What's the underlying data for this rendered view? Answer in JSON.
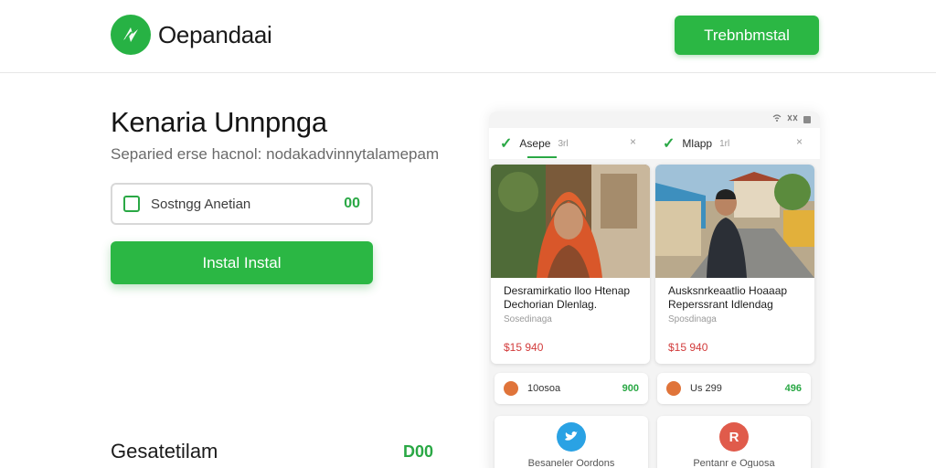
{
  "header": {
    "app_name": "Oepandaai",
    "cta_label": "Trebnbmstal"
  },
  "hero": {
    "title": "Kenaria Unnpnga",
    "subtitle": "Separied erse hacnol: nodakadvinnytalamepam",
    "input": {
      "value": "Sostngg Anetian",
      "count": "00"
    },
    "install_label": "Instal Instal"
  },
  "section": {
    "title": "Gesatetilam",
    "count": "D00"
  },
  "phone": {
    "status_icons": [
      "wifi-icon",
      "signal-icon",
      "battery-icon"
    ],
    "tabs": [
      {
        "label": "Asepe",
        "suffix": "3rl",
        "close": "×"
      },
      {
        "label": "Mlapp",
        "suffix": "1rl",
        "close": "×"
      }
    ],
    "cards": [
      {
        "title_line1": "Desramirkatio lloo Htenap",
        "title_line2": "Dechorian  Dlenlag.",
        "meta": "Sosedinaga",
        "price": "$15 940"
      },
      {
        "title_line1": "Ausksnrkeaatlio Hoaaap",
        "title_line2": "Reperssrant  Idlendag",
        "meta": "Sposdinaga",
        "price": "$15 940"
      }
    ],
    "mini_rows": [
      {
        "label": "10osoa",
        "count": "900"
      },
      {
        "label": "Us 299",
        "count": "496"
      }
    ],
    "bottom_cards": [
      {
        "label": "Besaneler Oordons",
        "icon": "bird-icon"
      },
      {
        "label": "Pentanr e Oguosa",
        "icon": "r-badge-icon",
        "glyph": "R"
      }
    ]
  },
  "colors": {
    "brand_green": "#2bb744",
    "price_red": "#d23b3b",
    "twitter_blue": "#2aa2e4",
    "badge_red": "#e05b4b"
  }
}
